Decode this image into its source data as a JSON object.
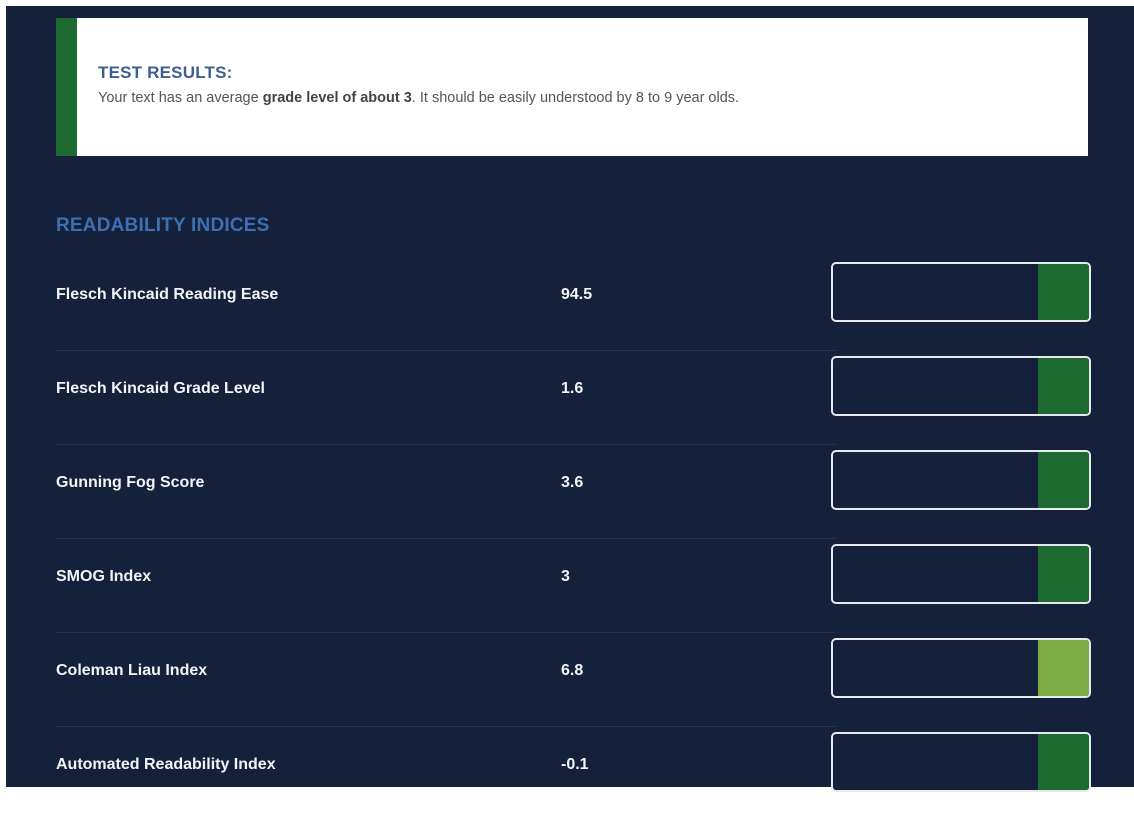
{
  "test_results": {
    "title": "TEST RESULTS:",
    "text_before": "Your text has an average ",
    "text_bold": "grade level of about 3",
    "text_after": ". It should be easily understood by 8 to 9 year olds."
  },
  "readability": {
    "title": "READABILITY INDICES",
    "items": [
      {
        "name": "Flesch Kincaid Reading Ease",
        "value": "94.5",
        "meter_fill_percent": 20,
        "meter_color": "#1e6b32"
      },
      {
        "name": "Flesch Kincaid Grade Level",
        "value": "1.6",
        "meter_fill_percent": 20,
        "meter_color": "#1e6b32"
      },
      {
        "name": "Gunning Fog Score",
        "value": "3.6",
        "meter_fill_percent": 20,
        "meter_color": "#1e6b32"
      },
      {
        "name": "SMOG Index",
        "value": "3",
        "meter_fill_percent": 20,
        "meter_color": "#1e6b32"
      },
      {
        "name": "Coleman Liau Index",
        "value": "6.8",
        "meter_fill_percent": 20,
        "meter_color": "#7dab45"
      },
      {
        "name": "Automated Readability Index",
        "value": "-0.1",
        "meter_fill_percent": 20,
        "meter_color": "#1e6b32"
      }
    ]
  },
  "colors": {
    "background": "#15213a",
    "accent_green": "#1e6b32",
    "light_green": "#7dab45",
    "section_title_blue": "#3e6fb3"
  }
}
